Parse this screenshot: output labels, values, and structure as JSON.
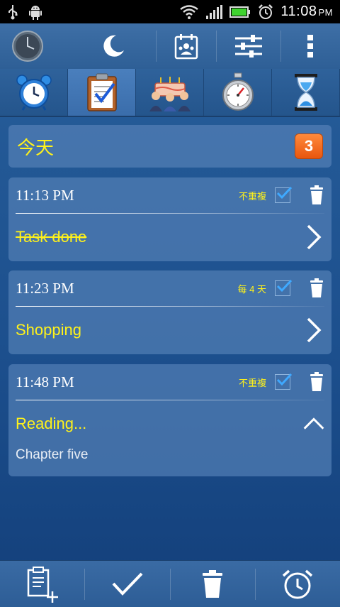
{
  "status_bar": {
    "time": "11:08",
    "ampm": "PM",
    "icons": [
      "usb-icon",
      "android-debug-icon",
      "wifi-icon",
      "signal-icon",
      "battery-icon",
      "alarm-clock-icon"
    ]
  },
  "action_bar": {
    "icons": [
      "app-clock-icon",
      "night-mode-icon",
      "calendar-contacts-icon",
      "settings-sliders-icon",
      "overflow-menu-icon"
    ]
  },
  "tabs": [
    {
      "icon": "alarm-clock-tab-icon"
    },
    {
      "icon": "tasks-tab-icon",
      "active": true
    },
    {
      "icon": "birthday-tab-icon"
    },
    {
      "icon": "stopwatch-tab-icon"
    },
    {
      "icon": "timer-tab-icon"
    }
  ],
  "header": {
    "title": "今天",
    "count": "3"
  },
  "tasks": [
    {
      "time": "11:13 PM",
      "repeat": "不重複",
      "checked": true,
      "title": "Task done",
      "done": true,
      "expanded": false,
      "note": ""
    },
    {
      "time": "11:23 PM",
      "repeat": "每 4 天",
      "checked": true,
      "title": "Shopping",
      "done": false,
      "expanded": false,
      "note": ""
    },
    {
      "time": "11:48 PM",
      "repeat": "不重複",
      "checked": true,
      "title": "Reading...",
      "done": false,
      "expanded": true,
      "note": "Chapter five"
    }
  ],
  "bottom_bar": {
    "icons": [
      "add-task-icon",
      "mark-done-icon",
      "delete-icon",
      "alarm-icon"
    ]
  },
  "colors": {
    "accent_yellow": "#fff21a",
    "badge_orange": "#ef6a1c",
    "check_blue": "#3fa9ff"
  }
}
